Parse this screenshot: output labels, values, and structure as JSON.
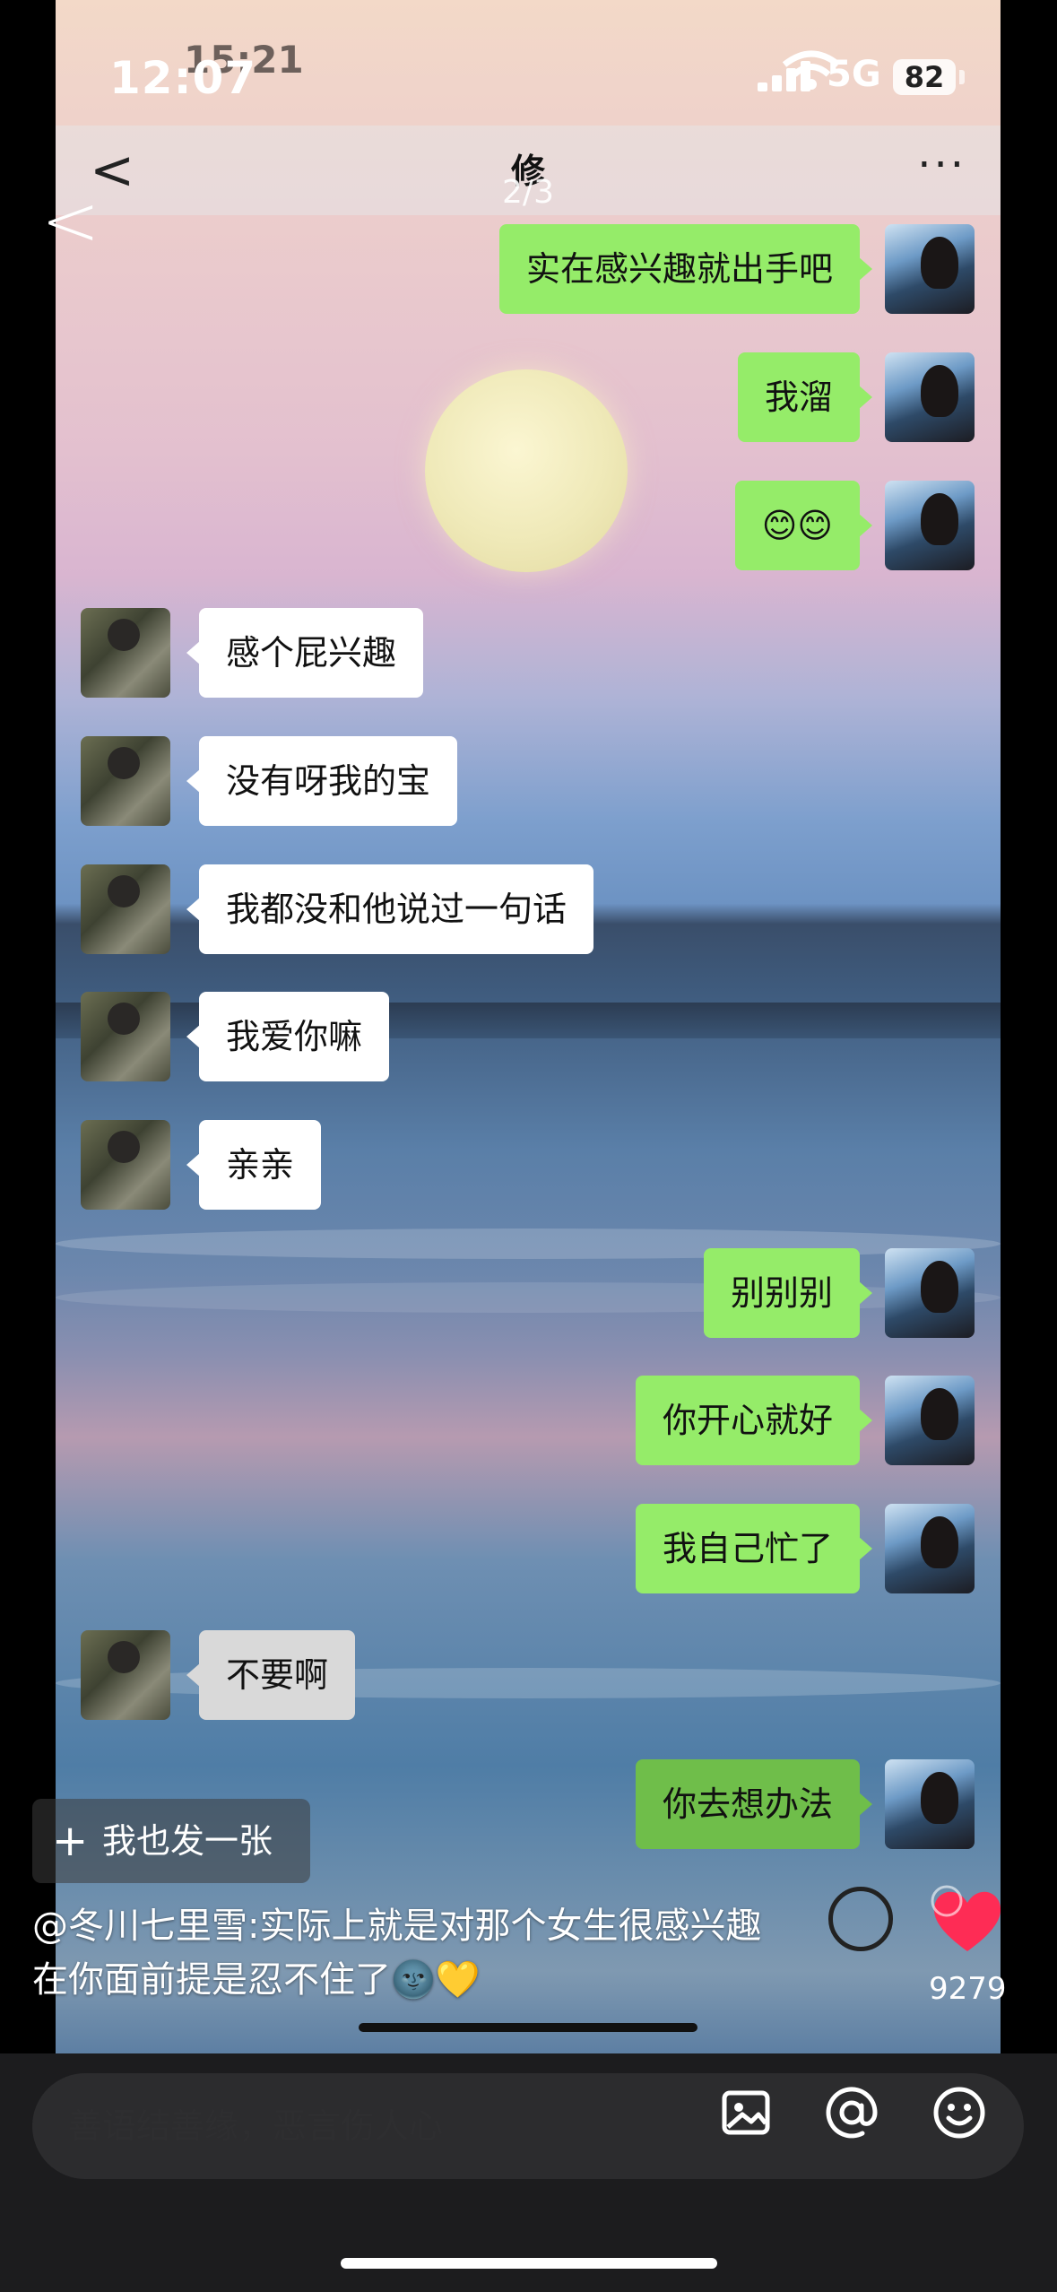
{
  "status_bar": {
    "time": "12:07",
    "time_overlay": "15:21",
    "network": "5G",
    "battery": "82"
  },
  "chat_header": {
    "back_glyph": "<",
    "title": "修",
    "page_indicator": "2/3",
    "more_glyph": "···"
  },
  "viewer_back_glyph": "<",
  "messages": [
    {
      "side": "right",
      "text": "实在感兴趣就出手吧"
    },
    {
      "side": "right",
      "text": "我溜"
    },
    {
      "side": "right",
      "text": "😊😊"
    },
    {
      "side": "left",
      "text": "感个屁兴趣"
    },
    {
      "side": "left",
      "text": "没有呀我的宝"
    },
    {
      "side": "left",
      "text": "我都没和他说过一句话"
    },
    {
      "side": "left",
      "text": "我爱你嘛"
    },
    {
      "side": "left",
      "text": "亲亲"
    },
    {
      "side": "right",
      "text": "别别别"
    },
    {
      "side": "right",
      "text": "你开心就好"
    },
    {
      "side": "right",
      "text": "我自己忙了"
    },
    {
      "side": "left",
      "text": "不要啊"
    },
    {
      "side": "right",
      "text": "你去想办法"
    }
  ],
  "overlay": {
    "post_button_plus": "+",
    "post_button_label": "我也发一张",
    "caption_line1": "@冬川七里雪:实际上就是对那个女生很感兴趣",
    "caption_line2": "在你面前提是忍不住了🌚💛",
    "like_count": "9279"
  },
  "comment_bar": {
    "placeholder": "善语结善缘，恶言伤人心",
    "icons": [
      "image-icon",
      "at-icon",
      "emoji-icon"
    ]
  },
  "colors": {
    "bubble_green": "#95ec69",
    "bubble_white": "#ffffff",
    "like_red": "#fe2c55"
  }
}
